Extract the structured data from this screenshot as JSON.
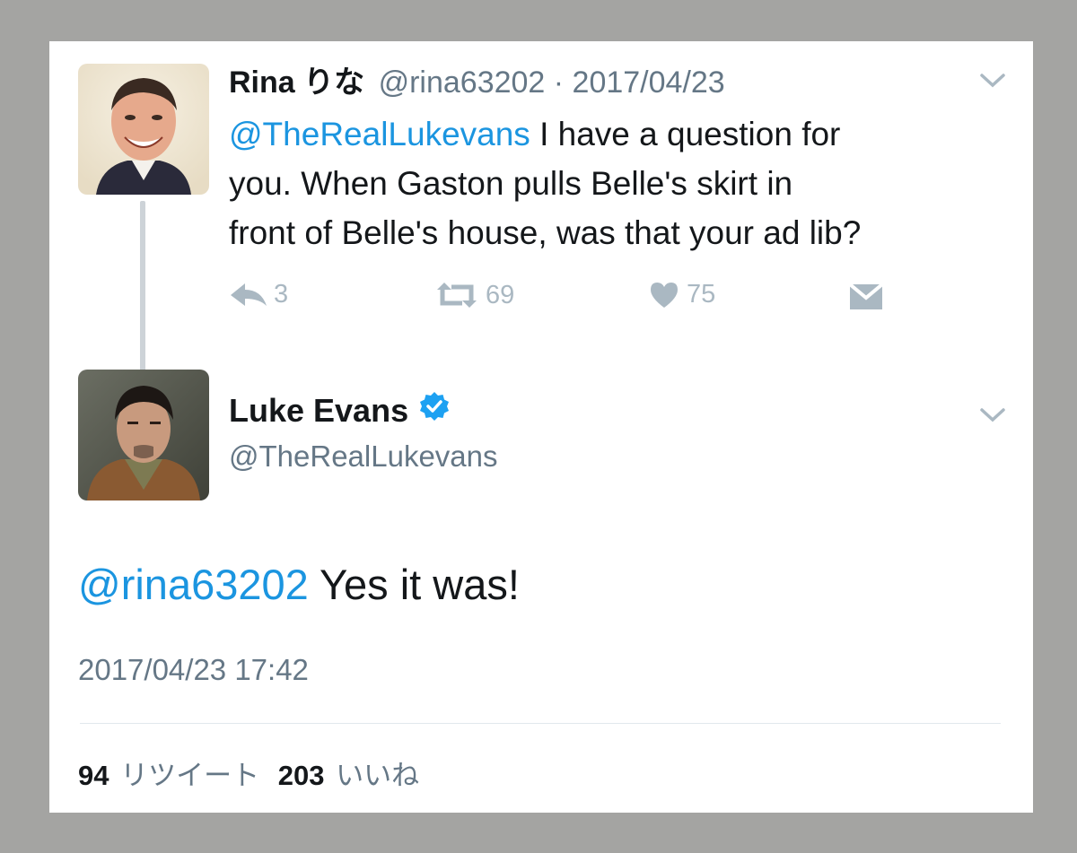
{
  "colors": {
    "link": "#1b95e0",
    "text": "#14171a",
    "muted": "#657786",
    "icon": "#aab8c2",
    "verified": "#1da1f2"
  },
  "reply_tweet": {
    "display_name": "Rina りな",
    "handle_date": "@rina63202 · 2017/04/23",
    "mention": "@TheRealLukevans",
    "text_lines": [
      " I have a question for",
      "you. When Gaston pulls Belle's skirt in",
      "front of Belle's house, was that your ad lib?"
    ],
    "actions": {
      "reply_count": "3",
      "retweet_count": "69",
      "like_count": "75"
    },
    "icons": [
      "reply-icon",
      "retweet-icon",
      "heart-icon",
      "direct-message-icon",
      "chevron-down-icon"
    ]
  },
  "main_tweet": {
    "display_name": "Luke Evans",
    "handle": "@TheRealLukevans",
    "mention": "@rina63202",
    "text": " Yes it was!",
    "timestamp": "2017/04/23 17:42",
    "stats": {
      "retweets_count": "94",
      "retweets_label": "リツイート",
      "likes_count": "203",
      "likes_label": "いいね"
    },
    "icons": [
      "verified-badge-icon",
      "chevron-down-icon"
    ]
  }
}
